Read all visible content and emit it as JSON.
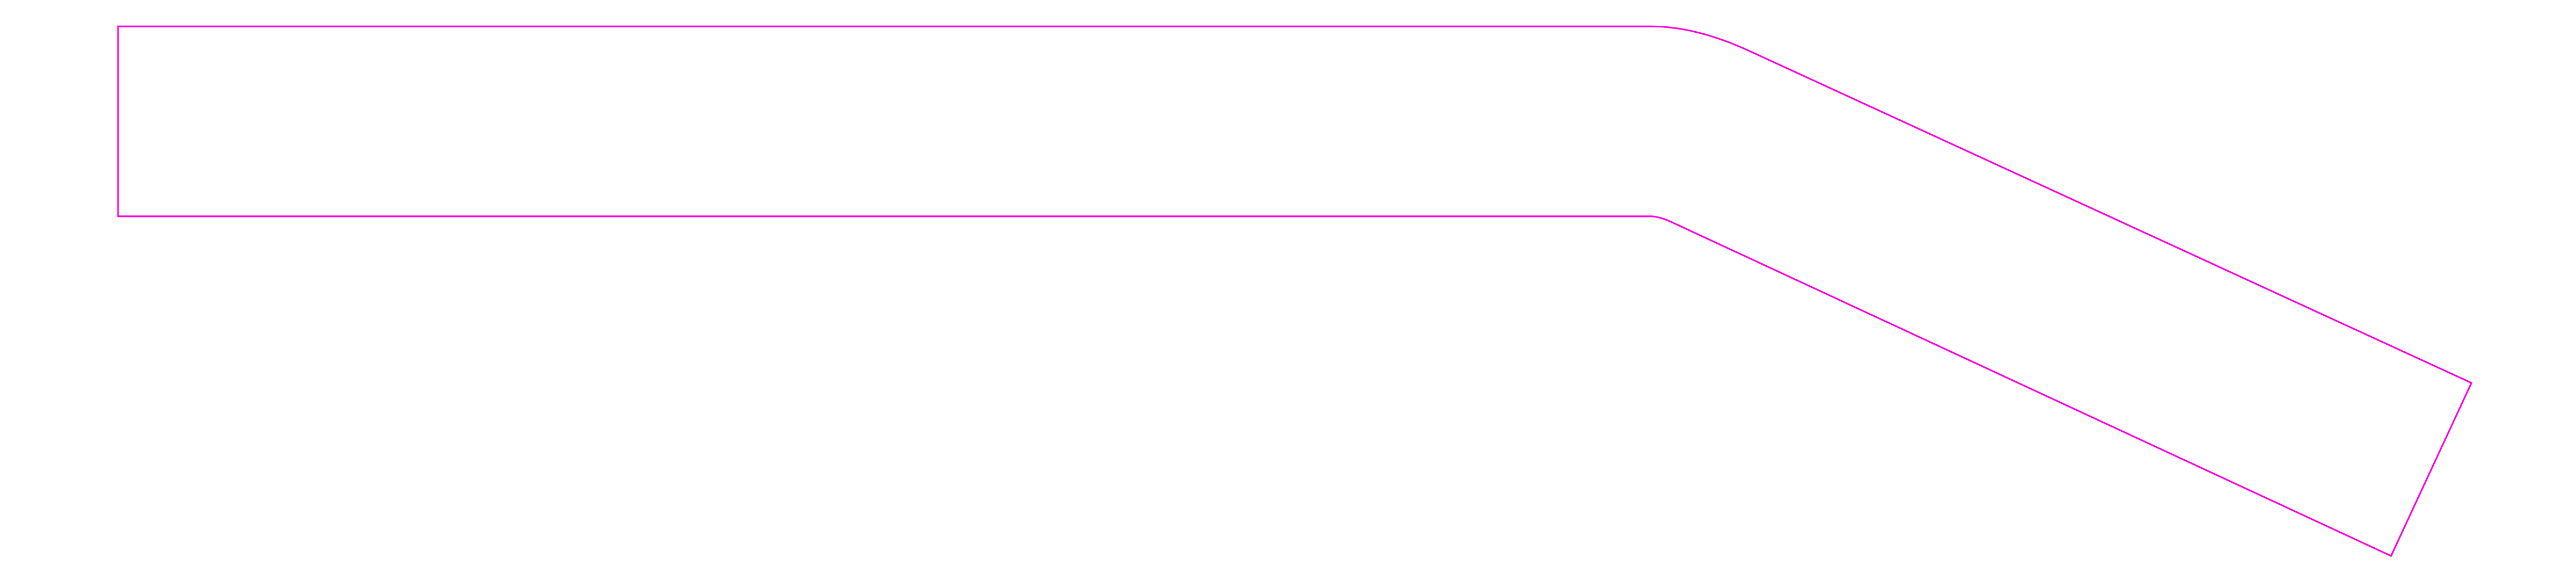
{
  "drawing": {
    "shape": "bent-bar-outline",
    "stroke_color": "#ff00dd",
    "background_color": "#ffffff"
  }
}
